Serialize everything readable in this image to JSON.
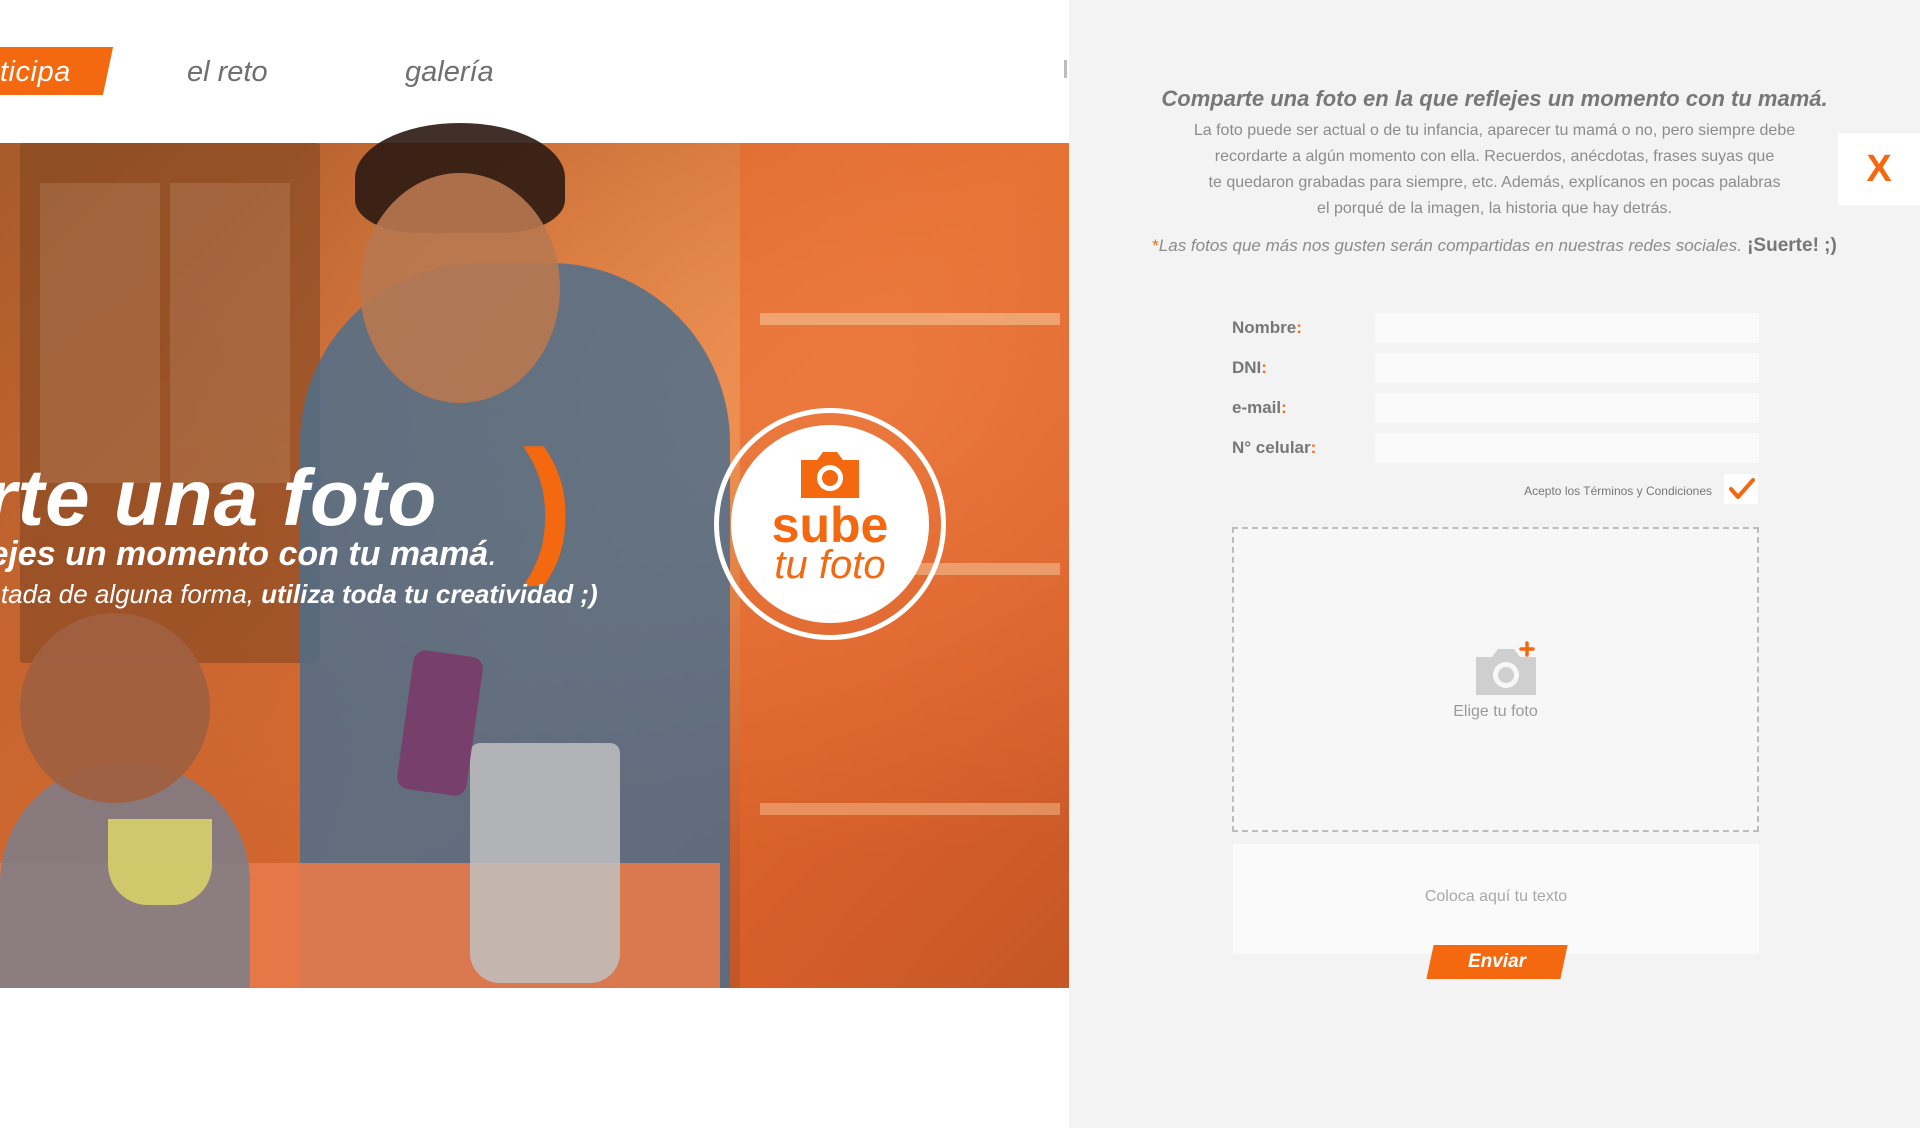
{
  "nav": {
    "active": "ticipa",
    "items": [
      "el reto",
      "galería"
    ]
  },
  "hero": {
    "title": "parte una foto",
    "paren": ")",
    "line2_bold": "lejes un momento con tu mamá",
    "line2_end": ".",
    "line3_normal": "entada de alguna forma, ",
    "line3_bold": "utiliza toda tu creatividad",
    "line3_end": " ;)"
  },
  "upload_badge": {
    "line1": "sube",
    "line2": "tu foto",
    "icon": "camera-icon"
  },
  "panel": {
    "close": "X",
    "title": "Comparte una foto en la que reflejes un momento con tu mamá.",
    "description": [
      "La foto puede ser actual o de tu infancia, aparecer tu mamá o no, pero siempre debe",
      "recordarte a algún momento con ella. Recuerdos, anécdotas, frases suyas que",
      "te quedaron grabadas para siempre, etc. Además, explícanos en pocas palabras",
      "el porqué de la imagen, la historia que hay detrás."
    ],
    "note_asterisk": "*",
    "note": "Las fotos que más nos gusten serán compartidas en nuestras redes sociales.",
    "note_end": " ¡Suerte! ;)"
  },
  "form": {
    "nombre_label": "Nombre",
    "dni_label": "DNI",
    "email_label": "e-mail",
    "celular_label": "N° celular",
    "colon": ":",
    "nombre_value": "",
    "dni_value": "",
    "email_value": "",
    "celular_value": "",
    "terms_label": "Acepto los Términos y Condiciones",
    "terms_checked": true,
    "upload_label": "Elige tu foto",
    "upload_icon": "camera-plus-icon",
    "text_placeholder": "Coloca aquí tu texto",
    "submit_label": "Enviar"
  },
  "colors": {
    "accent": "#f46810",
    "panel_bg": "#f3f3f3",
    "text_gray": "#777777"
  }
}
